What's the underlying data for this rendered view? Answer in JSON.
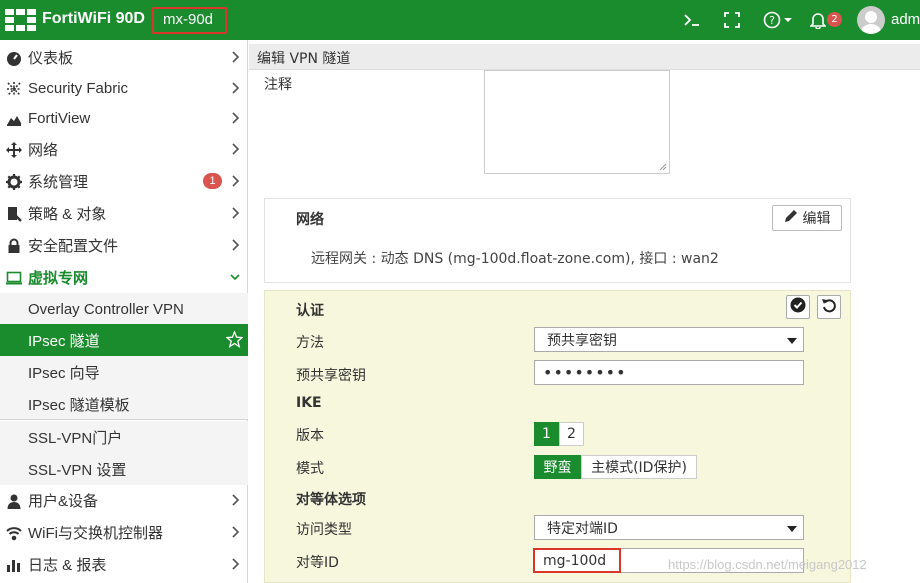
{
  "header": {
    "brand": "FortiWiFi 90D",
    "hostname": "mx-90d",
    "notification_count": "2",
    "username": "admin"
  },
  "sidebar": {
    "items": [
      {
        "label": "仪表板",
        "icon": "dashboard-icon"
      },
      {
        "label": "Security Fabric",
        "icon": "fabric-icon"
      },
      {
        "label": "FortiView",
        "icon": "chart-icon"
      },
      {
        "label": "网络",
        "icon": "network-icon"
      },
      {
        "label": "系统管理",
        "icon": "gear-icon",
        "badge": "1"
      },
      {
        "label": "策略 & 对象",
        "icon": "policy-icon"
      },
      {
        "label": "安全配置文件",
        "icon": "lock-icon"
      },
      {
        "label": "虚拟专网",
        "icon": "monitor-icon",
        "expanded": true
      },
      {
        "label": "用户&设备",
        "icon": "user-icon"
      },
      {
        "label": "WiFi与交换机控制器",
        "icon": "wifi-icon"
      },
      {
        "label": "日志 & 报表",
        "icon": "bar-chart-icon"
      }
    ],
    "vpn_sub": [
      {
        "label": "Overlay Controller VPN"
      },
      {
        "label": "IPsec 隧道",
        "selected": true
      },
      {
        "label": "IPsec 向导"
      },
      {
        "label": "IPsec 隧道模板"
      },
      {
        "label": "SSL-VPN门户"
      },
      {
        "label": "SSL-VPN 设置"
      }
    ]
  },
  "page": {
    "title": "编辑 VPN 隧道",
    "comment_label": "注释"
  },
  "network": {
    "title": "网络",
    "edit_label": "编辑",
    "remote_gateway": "远程网关 : 动态 DNS (mg-100d.float-zone.com), 接口 : wan2"
  },
  "auth": {
    "title": "认证",
    "method_label": "方法",
    "method_value": "预共享密钥",
    "psk_label": "预共享密钥",
    "psk_value": "••••••••",
    "ike_label": "IKE",
    "version_label": "版本",
    "version_options": [
      "1",
      "2"
    ],
    "mode_label": "模式",
    "mode_options": [
      "野蛮",
      "主模式(ID保护)"
    ],
    "peer_options_label": "对等体选项",
    "access_type_label": "访问类型",
    "access_type_value": "特定对端ID",
    "peer_id_label": "对等ID",
    "peer_id_value": "mg-100d"
  },
  "watermark": "https://blog.csdn.net/meigang2012",
  "colors": {
    "brand_green": "#1b8c2e",
    "badge_red": "#d9534f",
    "highlight_red": "#d9372a"
  }
}
